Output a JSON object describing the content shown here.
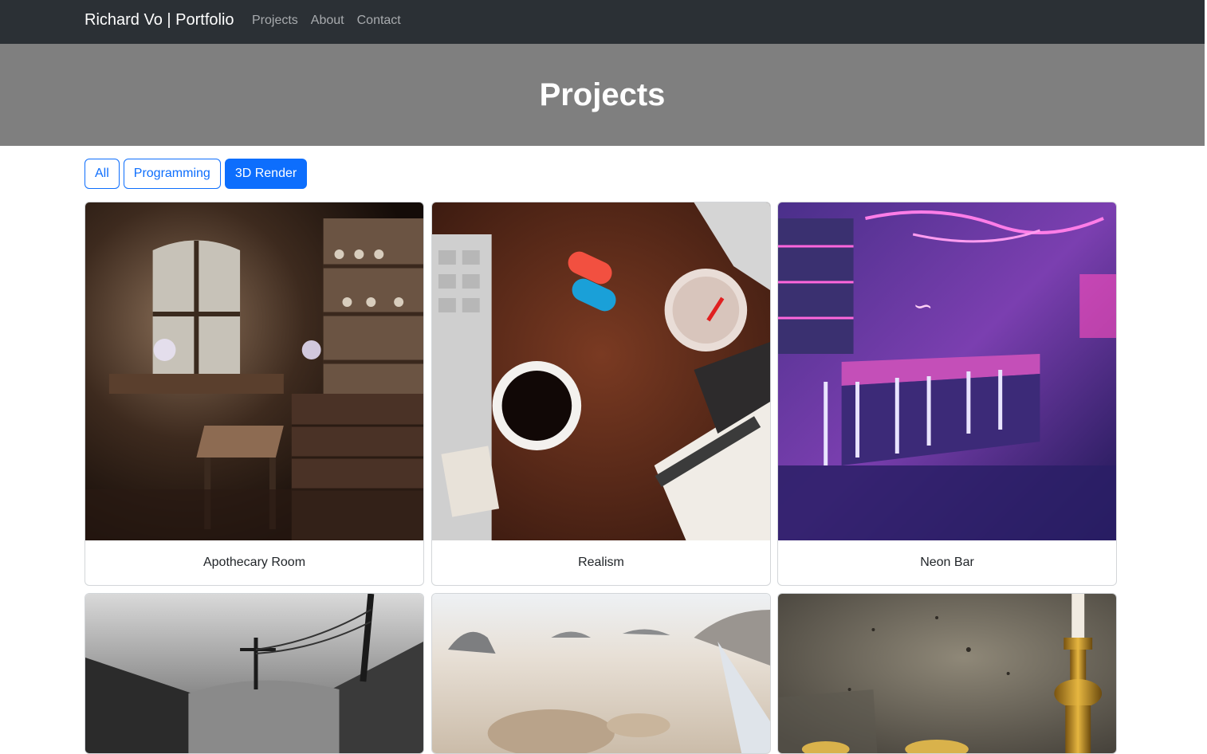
{
  "navbar": {
    "brand": "Richard Vo | Portfolio",
    "links": [
      "Projects",
      "About",
      "Contact"
    ]
  },
  "hero": {
    "title": "Projects"
  },
  "filters": {
    "buttons": [
      "All",
      "Programming",
      "3D Render"
    ],
    "active": "3D Render",
    "accent_color": "#0d6efd"
  },
  "projects": [
    {
      "title": "Apothecary Room",
      "image": "apothecary-room-render"
    },
    {
      "title": "Realism",
      "image": "desk-still-life-render"
    },
    {
      "title": "Neon Bar",
      "image": "neon-bar-render"
    },
    {
      "title": "",
      "image": "trench-black-white-render"
    },
    {
      "title": "",
      "image": "desert-rocks-render"
    },
    {
      "title": "",
      "image": "candle-still-life-render"
    }
  ]
}
